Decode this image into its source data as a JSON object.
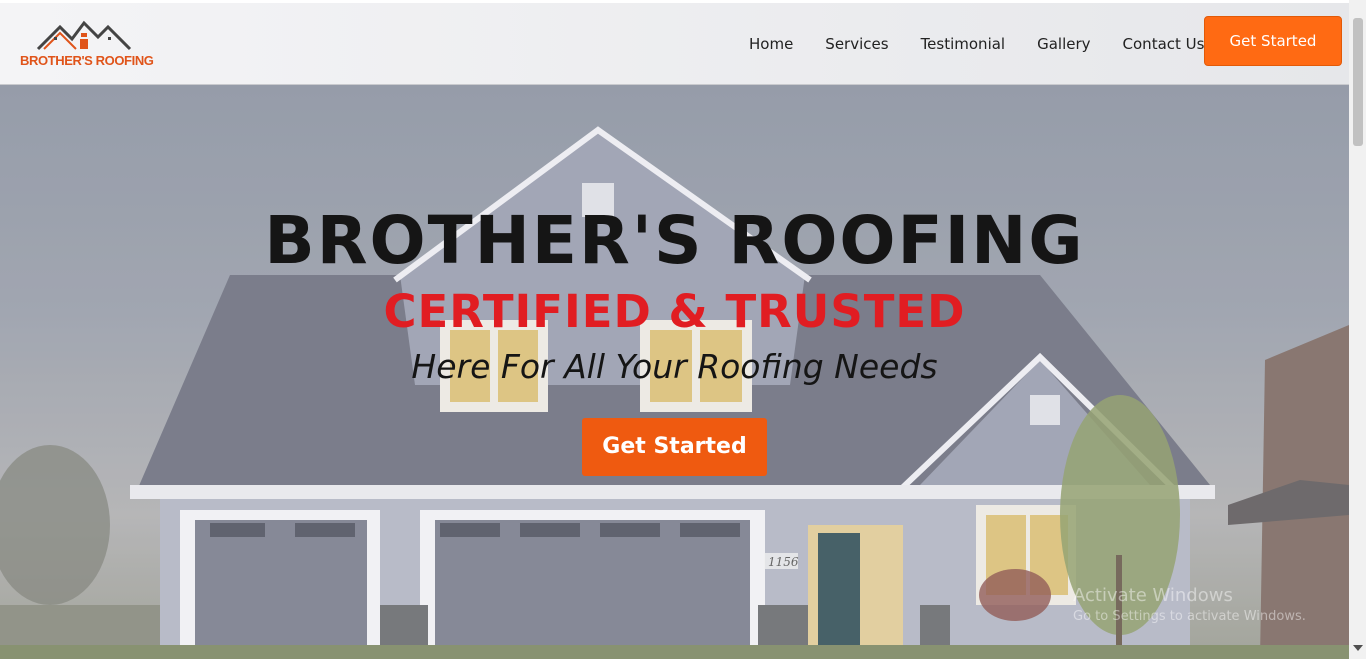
{
  "brand": {
    "name": "BROTHER'S ROOFING"
  },
  "nav": {
    "items": [
      {
        "label": "Home"
      },
      {
        "label": "Services"
      },
      {
        "label": "Testimonial"
      },
      {
        "label": "Gallery"
      },
      {
        "label": "Contact Us"
      }
    ],
    "cta_label": "Get Started"
  },
  "hero": {
    "title": "BROTHER'S ROOFING",
    "subtitle": "CERTIFIED & TRUSTED",
    "tagline": "Here For All Your Roofing Needs",
    "cta_label": "Get Started",
    "house_number": "1156"
  },
  "watermark": {
    "line1": "Activate Windows",
    "line2": "Go to Settings to activate Windows."
  },
  "colors": {
    "accent": "#ff6a13",
    "subtitle_red": "#e11d22",
    "logo_orange": "#e0541a"
  },
  "icons": [
    "roof-logo-icon"
  ]
}
